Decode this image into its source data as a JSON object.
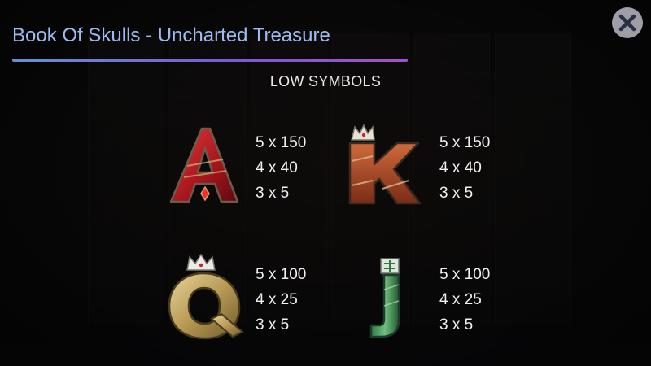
{
  "header": {
    "title": "Book Of Skulls - Uncharted Treasure",
    "close_icon": "close-icon"
  },
  "section": {
    "heading": "LOW SYMBOLS"
  },
  "symbols": [
    {
      "name": "A",
      "icon": "letter-a-symbol-icon",
      "payouts": [
        "5 x 150",
        "4 x 40",
        "3 x 5"
      ]
    },
    {
      "name": "K",
      "icon": "letter-k-symbol-icon",
      "payouts": [
        "5 x 150",
        "4 x 40",
        "3 x 5"
      ]
    },
    {
      "name": "Q",
      "icon": "letter-q-symbol-icon",
      "payouts": [
        "5 x 100",
        "4 x 25",
        "3 x 5"
      ]
    },
    {
      "name": "J",
      "icon": "letter-j-symbol-icon",
      "payouts": [
        "5 x 100",
        "4 x 25",
        "3 x 5"
      ]
    }
  ],
  "colors": {
    "title": "#9dbcf2",
    "underline_start": "#6a8fd6",
    "underline_end": "#a352c9",
    "text": "#f2f2f2"
  }
}
